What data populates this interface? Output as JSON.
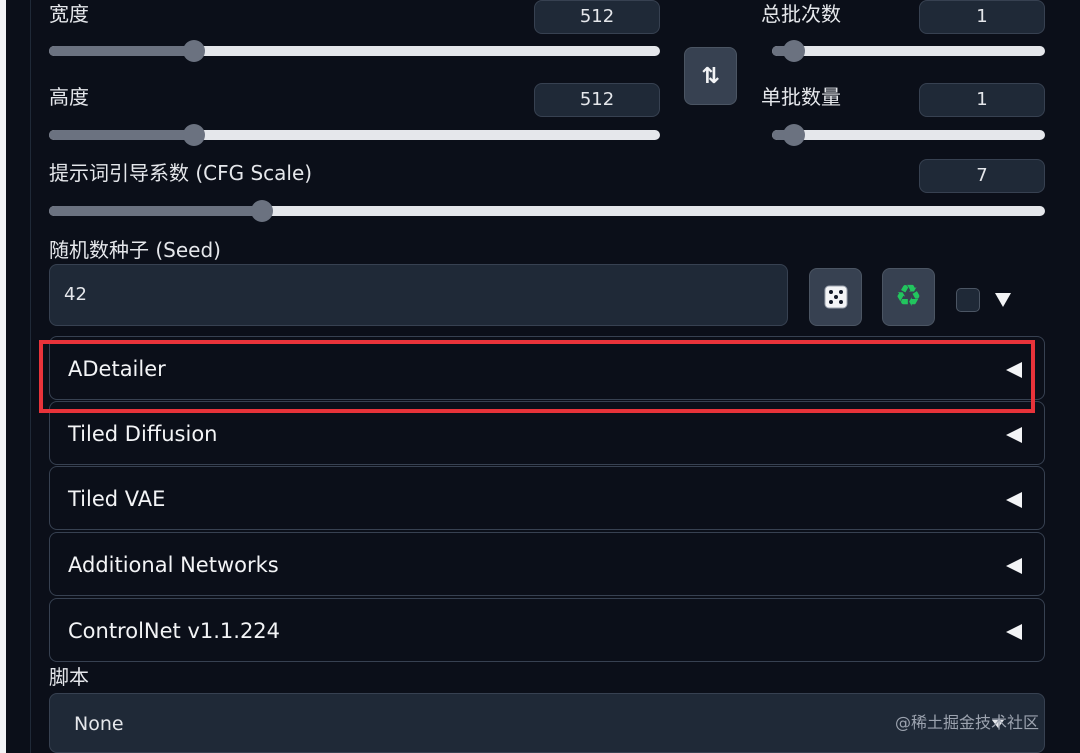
{
  "width": {
    "label": "宽度",
    "value": "512",
    "slider_fraction": 0.237
  },
  "height": {
    "label": "高度",
    "value": "512",
    "slider_fraction": 0.237
  },
  "batch_count": {
    "label": "总批次数",
    "value": "1",
    "slider_fraction": 0.0
  },
  "batch_size": {
    "label": "单批数量",
    "value": "1",
    "slider_fraction": 0.0
  },
  "swap_button": {
    "glyph": "⇅",
    "icon": "swap-dimensions-icon"
  },
  "cfg_scale": {
    "label": "提示词引导系数 (CFG Scale)",
    "value": "7",
    "slider_fraction": 0.214
  },
  "seed": {
    "label": "随机数种子 (Seed)",
    "value": "42",
    "random_icon": "dice-icon",
    "reuse_icon": "recycle-icon",
    "random_glyph": "🎲",
    "reuse_glyph": "♻"
  },
  "accordions": [
    {
      "label": "ADetailer",
      "highlighted": true
    },
    {
      "label": "Tiled Diffusion"
    },
    {
      "label": "Tiled VAE"
    },
    {
      "label": "Additional Networks"
    },
    {
      "label": "ControlNet v1.1.224"
    }
  ],
  "script": {
    "label": "脚本",
    "value": "None"
  },
  "watermark": "@稀土掘金技术社区",
  "colors": {
    "highlight": "#e8333a",
    "background": "#0b0f19"
  }
}
